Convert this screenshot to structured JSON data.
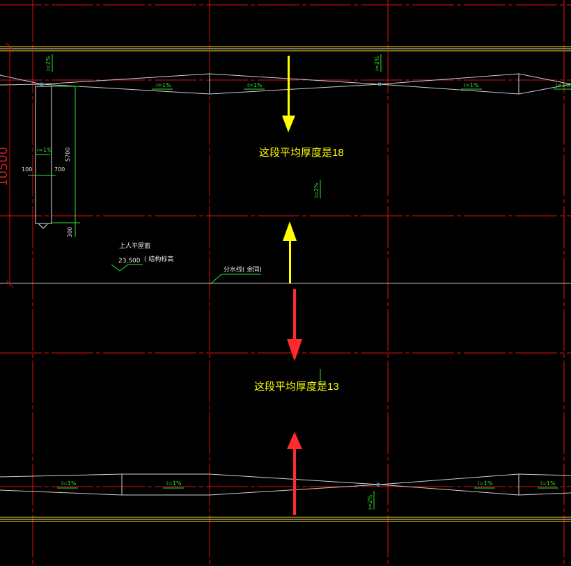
{
  "colors": {
    "background": "#000000",
    "grid_red": "#e01010",
    "line_white": "#d8d8d8",
    "line_green": "#2fe02f",
    "arrow_yellow": "#ffff00",
    "arrow_red": "#ff2a2a",
    "border_yellow": "#ffd700"
  },
  "annotations": {
    "upper_note": "这段平均厚度是18",
    "lower_note": "这段平均厚度是13",
    "left_dimension": "10500",
    "roof_label": "上人平屋面",
    "elevation": "23.500",
    "structure_label": "( 结构标高",
    "divide_line": "分水线( 余同)",
    "dim_5700": "5700",
    "dim_300": "300",
    "dim_100": "100",
    "dim_700": "700",
    "slope_1pct": "i=1%",
    "slope_2pct": "i=2%"
  },
  "icons": {
    "upper_arrow_down": "arrow-down-icon",
    "upper_arrow_up": "arrow-up-icon",
    "lower_arrow_down": "arrow-down-icon",
    "lower_arrow_up": "arrow-up-icon"
  }
}
